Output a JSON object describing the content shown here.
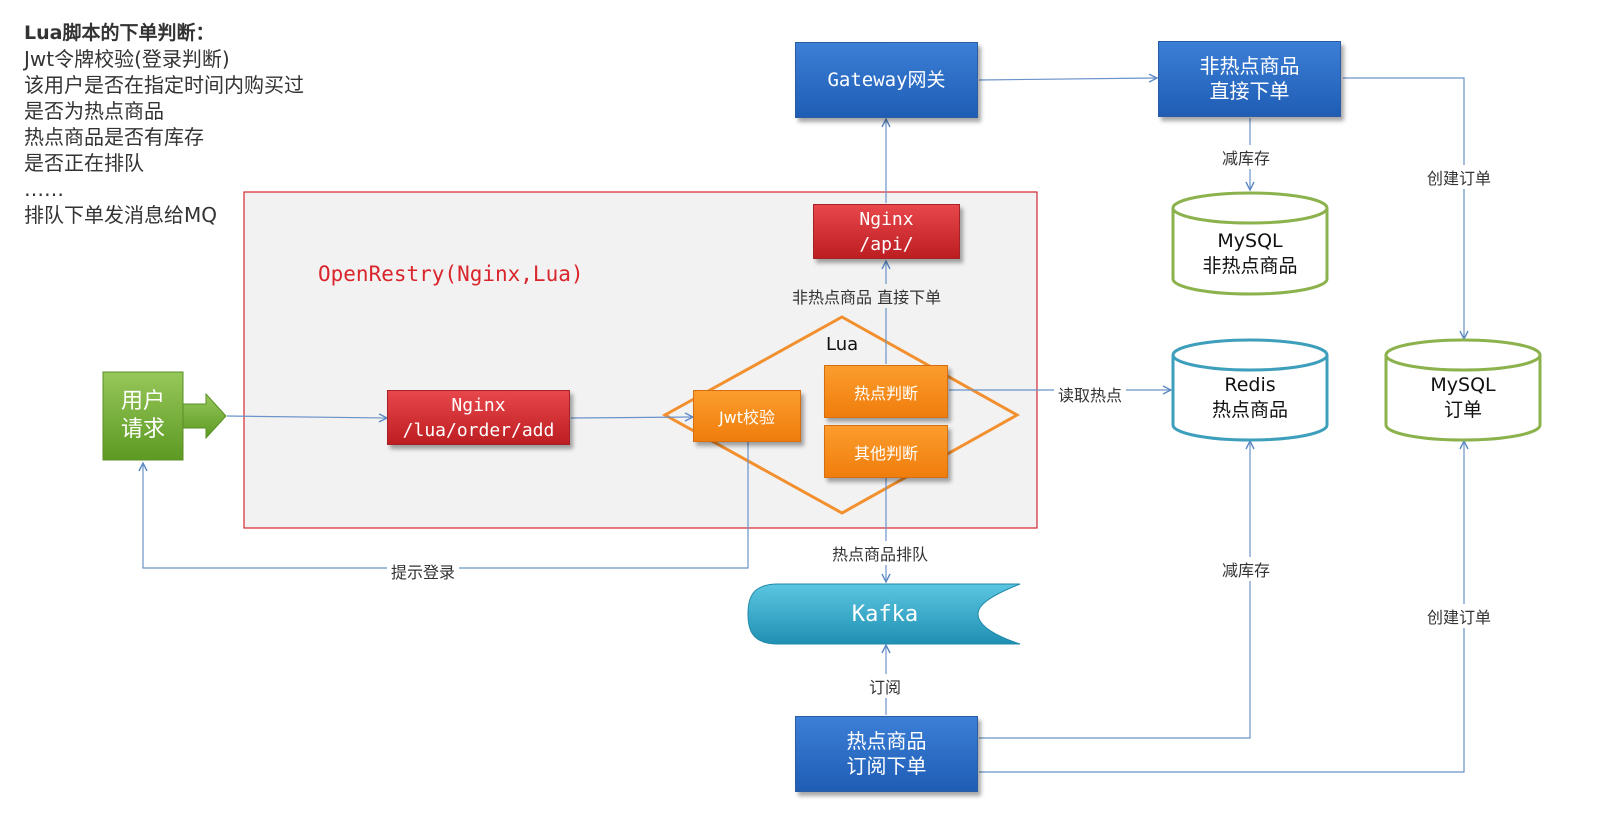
{
  "notes": {
    "title": "Lua脚本的下单判断：",
    "lines": [
      "Jwt令牌校验(登录判断)",
      "该用户是否在指定时间内购买过",
      "是否为热点商品",
      "热点商品是否有库存",
      "是否正在排队",
      "……",
      "排队下单发消息给MQ"
    ]
  },
  "container": {
    "title": "OpenRestry(Nginx,Lua)"
  },
  "nodes": {
    "user_request": {
      "line1": "用户",
      "line2": "请求"
    },
    "nginx_lua": {
      "line1": "Nginx",
      "line2": "/lua/order/add"
    },
    "jwt": {
      "label": "Jwt校验"
    },
    "lua": {
      "label": "Lua"
    },
    "hot_check": {
      "label": "热点判断"
    },
    "other_check": {
      "label": "其他判断"
    },
    "nginx_api": {
      "line1": "Nginx",
      "line2": "/api/"
    },
    "gateway": {
      "label": "Gateway网关"
    },
    "non_hot_order": {
      "line1": "非热点商品",
      "line2": "直接下单"
    },
    "mysql_non_hot": {
      "line1": "MySQL",
      "line2": "非热点商品"
    },
    "redis": {
      "line1": "Redis",
      "line2": "热点商品"
    },
    "mysql_order": {
      "line1": "MySQL",
      "line2": "订单"
    },
    "kafka": {
      "label": "Kafka"
    },
    "hot_subscribe": {
      "line1": "热点商品",
      "line2": "订阅下单"
    }
  },
  "edge_labels": {
    "non_hot_direct": "非热点商品 直接下单",
    "reduce_stock_top": "减库存",
    "create_order_top": "创建订单",
    "read_hot": "读取热点",
    "hot_queue": "热点商品排队",
    "prompt_login": "提示登录",
    "reduce_stock_bottom": "减库存",
    "create_order_bottom": "创建订单",
    "subscribe": "订阅"
  },
  "colors": {
    "blue": "#2a6cc8",
    "red": "#d2282d",
    "orange": "#f58a1f",
    "green": "#7bb03a",
    "cyan": "#31a5c4",
    "line": "#6a93c9"
  }
}
